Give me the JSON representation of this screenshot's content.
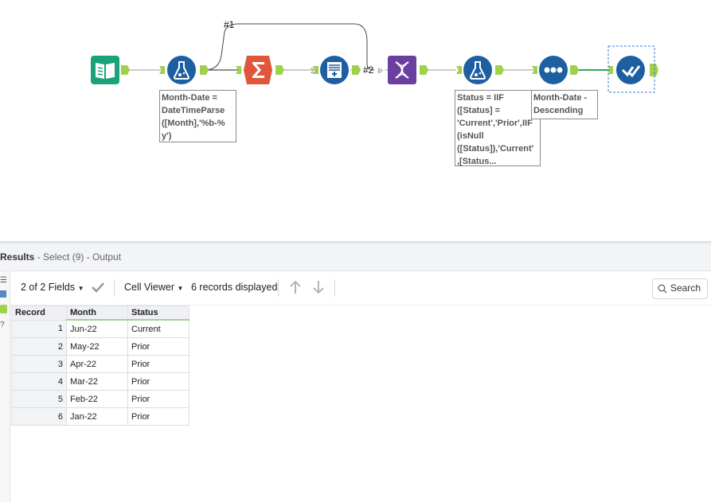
{
  "workflow": {
    "connection_labels": [
      "#1",
      "#2"
    ],
    "tools": [
      {
        "name": "Input Data",
        "icon": "book-icon",
        "color": "#1aa37a"
      },
      {
        "name": "Formula",
        "icon": "flask-icon",
        "color": "#1d5fa0"
      },
      {
        "name": "Summarize",
        "icon": "sigma-icon",
        "color": "#e0563b"
      },
      {
        "name": "Append Fields",
        "icon": "append-icon",
        "color": "#1d5fa0"
      },
      {
        "name": "Transpose",
        "icon": "dna-icon",
        "color": "#6b3fa0"
      },
      {
        "name": "Formula",
        "icon": "flask-icon",
        "color": "#1d5fa0"
      },
      {
        "name": "Sort",
        "icon": "dots-icon",
        "color": "#1d5fa0"
      },
      {
        "name": "Select",
        "icon": "check-icon",
        "color": "#1d5fa0"
      }
    ],
    "annotations": {
      "formula1": "Month-Date =\nDateTimeParse\n([Month],'%b-%\ny')",
      "formula2": "Status = IIF\n([Status] =\n'Current','Prior',IIF\n(isNull\n([Status]),'Current'\n,[Status...",
      "sort": "Month-Date -\nDescending"
    }
  },
  "results": {
    "title": "Results",
    "subtitle": " - Select (9) - Output",
    "toolbar": {
      "fields": "2 of 2 Fields",
      "viewer": "Cell Viewer",
      "records": "6 records displayed",
      "search": "Search"
    },
    "table": {
      "headers": [
        "Record",
        "Month",
        "Status"
      ],
      "rows": [
        {
          "record": "1",
          "month": "Jun-22",
          "status": "Current"
        },
        {
          "record": "2",
          "month": "May-22",
          "status": "Prior"
        },
        {
          "record": "3",
          "month": "Apr-22",
          "status": "Prior"
        },
        {
          "record": "4",
          "month": "Mar-22",
          "status": "Prior"
        },
        {
          "record": "5",
          "month": "Feb-22",
          "status": "Prior"
        },
        {
          "record": "6",
          "month": "Jan-22",
          "status": "Prior"
        }
      ]
    }
  }
}
